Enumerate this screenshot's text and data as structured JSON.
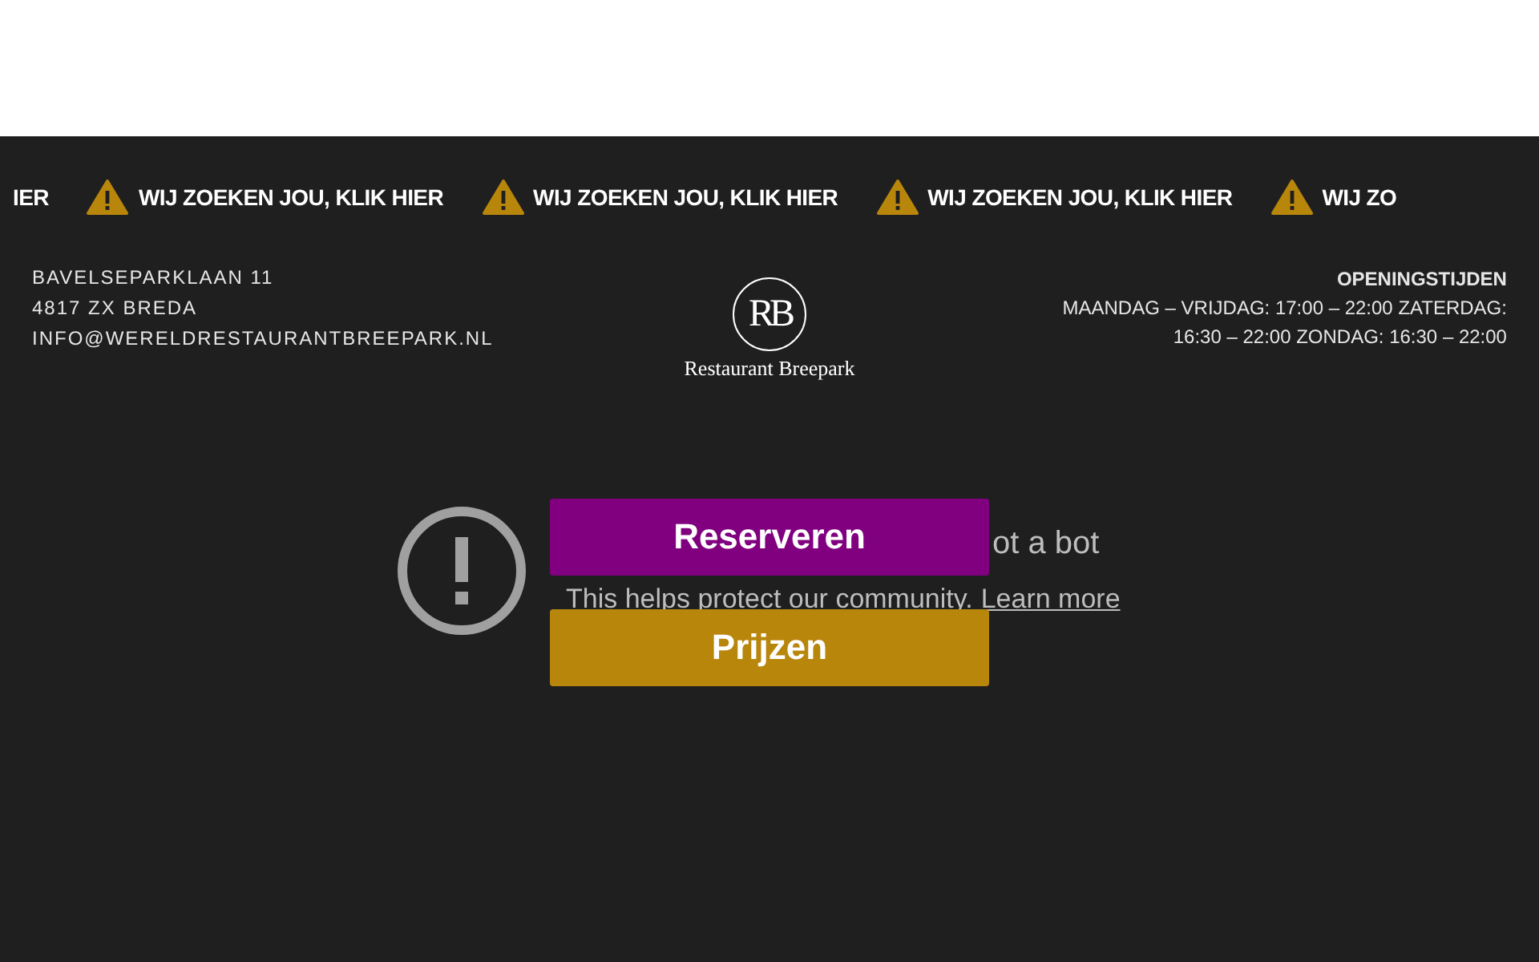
{
  "ticker": [
    {
      "text": "IER",
      "icon": false
    },
    {
      "text": "WIJ ZOEKEN JOU, KLIK HIER",
      "icon": true
    },
    {
      "text": "WIJ ZOEKEN JOU, KLIK HIER",
      "icon": true
    },
    {
      "text": "WIJ ZOEKEN JOU, KLIK HIER",
      "icon": true
    },
    {
      "text": "WIJ ZO",
      "icon": true
    }
  ],
  "address": [
    "BAVELSEPARKLAAN 11",
    "4817 ZX BREDA",
    "INFO@WERELDRESTAURANTBREEPARK.NL"
  ],
  "logo": {
    "monogram": "RB",
    "name": "Restaurant Breepark"
  },
  "hours": {
    "title": "OPENINGSTIJDEN",
    "lines": [
      "MAANDAG – VRIJDAG: 17:00 – 22:00 ZATERDAG:",
      "16:30 – 22:00 ZONDAG: 16:30 – 22:00"
    ]
  },
  "notice": {
    "heading": "ot a bot",
    "text": "This helps protect our community.",
    "link": "Learn more"
  },
  "buttons": [
    {
      "label": "Reserveren",
      "color": "#800080"
    },
    {
      "label": "Prijzen",
      "color": "#b8860b"
    }
  ]
}
